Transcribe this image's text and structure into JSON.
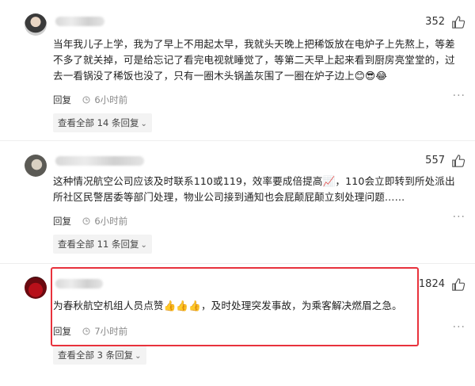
{
  "comments": [
    {
      "likes": "352",
      "text": "当年我儿子上学，我为了早上不用起太早，我就头天晚上把稀饭放在电炉子上先熬上，等差不多了就关掉，可是给忘记了看完电视就睡觉了，等第二天早上起来看到厨房亮堂堂的，过去一看锅没了稀饭也没了，只有一圈木头锅盖灰围了一圈在炉子边上😊😎😂",
      "reply": "回复",
      "time": "6小时前",
      "view_all": "查看全部 14 条回复"
    },
    {
      "likes": "557",
      "text": "这种情况航空公司应该及时联系110或119，效率要成倍提高📈，110会立即转到所处派出所社区民警居委等部门处理，物业公司接到通知也会屁颠屁颠立刻处理问题……",
      "reply": "回复",
      "time": "6小时前",
      "view_all": "查看全部 11 条回复"
    },
    {
      "likes": "1824",
      "text": "为春秋航空机组人员点赞👍👍👍，及时处理突发事故，为乘客解决燃眉之急。",
      "reply": "回复",
      "time": "7小时前",
      "view_all": "查看全部 3 条回复"
    }
  ],
  "icons": {
    "like": "thumb-up-icon",
    "time": "clock-icon",
    "more": "more-dots-icon",
    "expand": "chevron-down-icon"
  },
  "colors": {
    "highlight": "#e8323c"
  }
}
